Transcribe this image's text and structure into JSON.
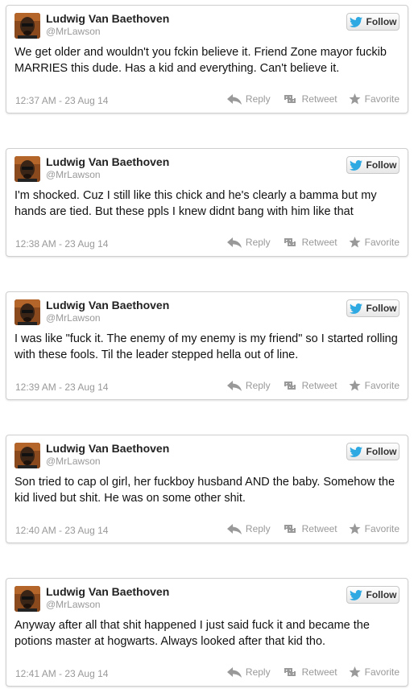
{
  "tweets": [
    {
      "name": "Ludwig Van Baethoven",
      "handle": "@MrLawson",
      "text": "We get older and wouldn't you fckin believe it. Friend Zone mayor fuckib MARRIES this dude. Has a kid and everything. Can't believe it.",
      "time": "12:37 AM - 23 Aug 14"
    },
    {
      "name": "Ludwig Van Baethoven",
      "handle": "@MrLawson",
      "text": "I'm shocked. Cuz I still like this chick and he's clearly a bamma but my hands are tied. But these ppls I knew didnt bang with him like that",
      "time": "12:38 AM - 23 Aug 14"
    },
    {
      "name": "Ludwig Van Baethoven",
      "handle": "@MrLawson",
      "text": "I was like \"fuck it. The enemy of my enemy is my friend\" so I started rolling with these fools. Til the leader stepped hella out of line.",
      "time": "12:39 AM - 23 Aug 14"
    },
    {
      "name": "Ludwig Van Baethoven",
      "handle": "@MrLawson",
      "text": "Son tried to cap ol girl, her fuckboy husband AND the baby. Somehow the kid lived but shit. He was on some other shit.",
      "time": "12:40 AM - 23 Aug 14"
    },
    {
      "name": "Ludwig Van Baethoven",
      "handle": "@MrLawson",
      "text": "Anyway after all that shit happened I just said fuck it and became the potions master at hogwarts. Always looked after that kid tho.",
      "time": "12:41 AM - 23 Aug 14"
    }
  ],
  "labels": {
    "follow": "Follow",
    "reply": "Reply",
    "retweet": "Retweet",
    "favorite": "Favorite"
  },
  "colors": {
    "twitter_blue": "#2fa9e2",
    "action_gray": "#999999",
    "name": "#222222"
  },
  "icons": {
    "follow": "twitter-bird-icon",
    "reply": "reply-arrow-icon",
    "retweet": "retweet-icon",
    "favorite": "star-icon"
  }
}
